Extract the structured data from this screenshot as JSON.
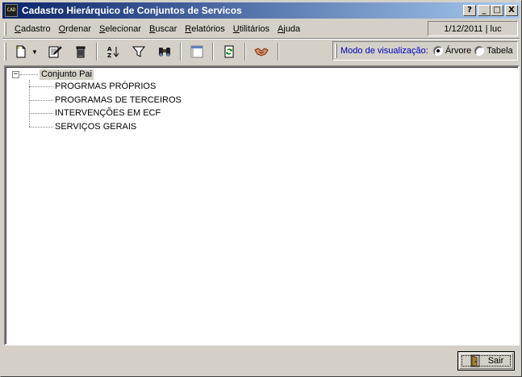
{
  "window": {
    "title": "Cadastro Hierárquico de Conjuntos de Servicos",
    "app_icon_text": "CAD",
    "controls": {
      "help": "?",
      "minimize": "_",
      "maximize": "□",
      "close": "X"
    }
  },
  "menu": {
    "items": [
      {
        "first": "C",
        "rest": "adastro"
      },
      {
        "first": "O",
        "rest": "rdenar"
      },
      {
        "first": "S",
        "rest": "elecionar"
      },
      {
        "first": "B",
        "rest": "uscar"
      },
      {
        "first": "R",
        "rest": "elatórios"
      },
      {
        "first": "U",
        "rest": "tilitários"
      },
      {
        "first": "A",
        "rest": "juda"
      }
    ],
    "status": "1/12/2011 | luc"
  },
  "toolbar": {
    "icons": [
      "new-document-icon",
      "edit-document-icon",
      "delete-trash-icon",
      "sort-az-icon",
      "filter-icon",
      "binoculars-find-icon",
      "layout-icon",
      "refresh-icon",
      "handshake-icon"
    ],
    "view_mode_label": "Modo de visualização:",
    "view_options": [
      {
        "label": "Árvore",
        "selected": true
      },
      {
        "label": "Tabela",
        "selected": false
      }
    ]
  },
  "tree": {
    "root": {
      "label": "Conjunto Pai",
      "expander": "−"
    },
    "children": [
      "PROGRMAS PRÓPRIOS",
      "PROGRAMAS DE TERCEIROS",
      "INTERVENÇÕES EM ECF",
      "SERVIÇOS GERAIS"
    ]
  },
  "footer": {
    "exit_label": "Sair"
  }
}
